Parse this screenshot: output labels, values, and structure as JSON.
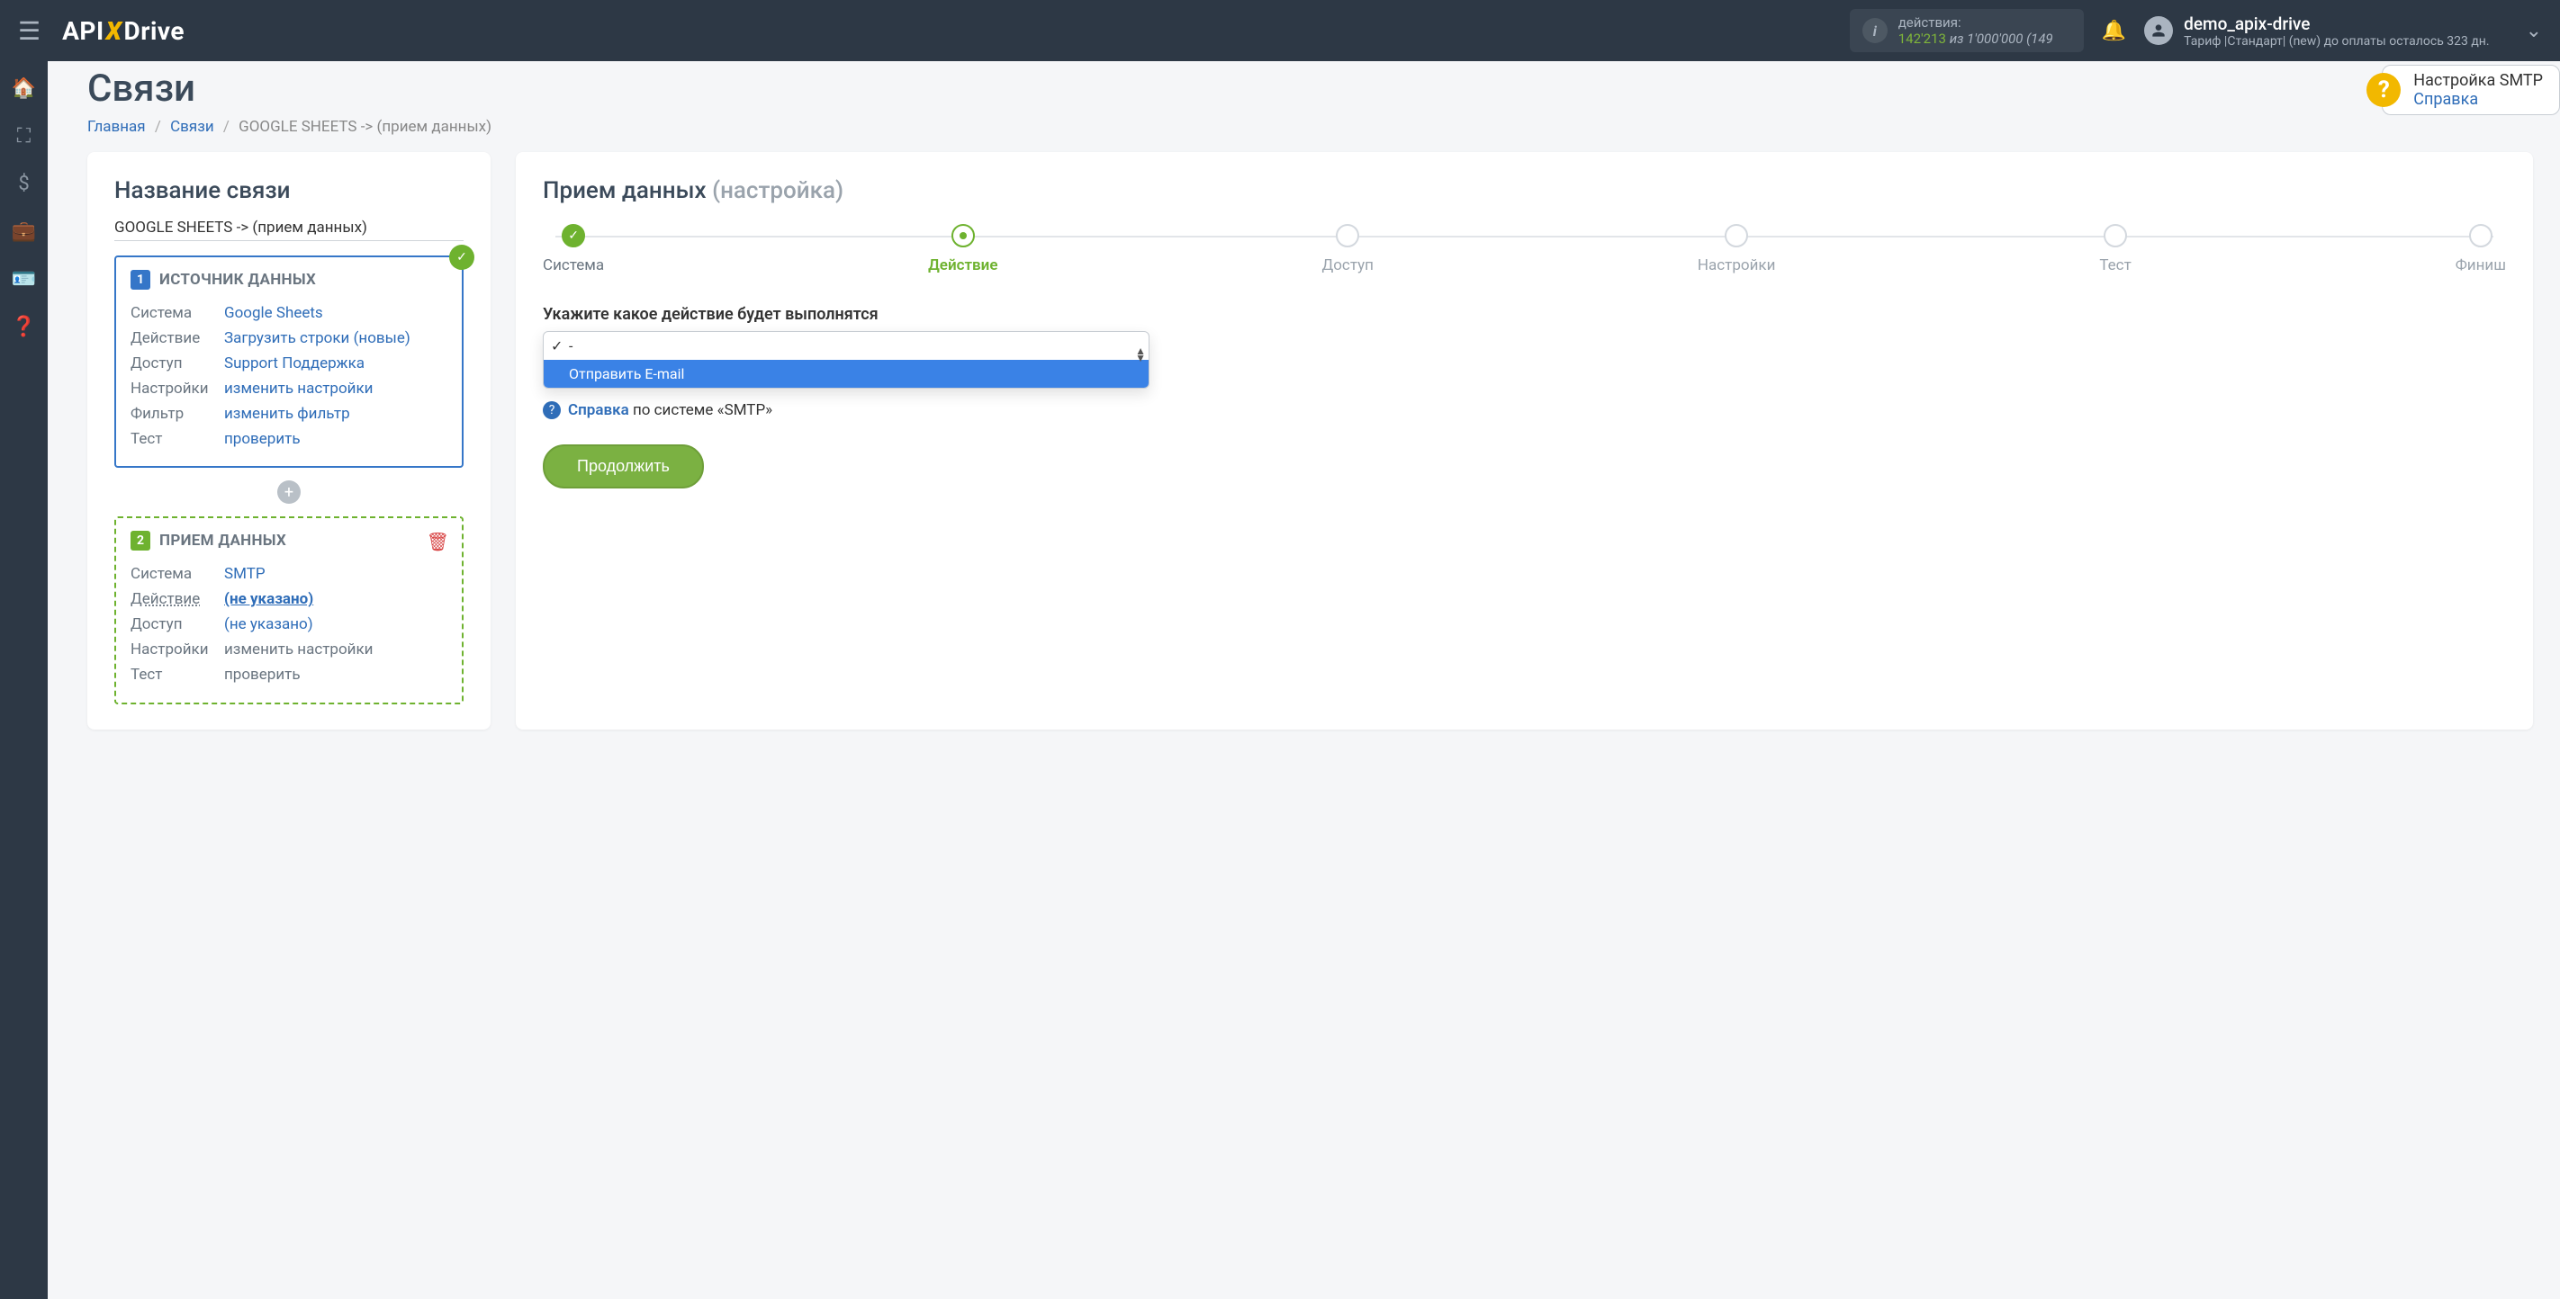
{
  "topbar": {
    "actions_label": "действия:",
    "actions_count": "142'213",
    "actions_of": "из",
    "actions_total": "1'000'000",
    "actions_rest": "(149",
    "user_name": "demo_apix-drive",
    "tariff": "Тариф |Стандарт| (new) до оплаты осталось 323 дн."
  },
  "help": {
    "title": "Настройка SMTP",
    "link": "Справка"
  },
  "page": {
    "title": "Связи",
    "crumb_home": "Главная",
    "crumb_links": "Связи",
    "crumb_current": "GOOGLE SHEETS -> (прием данных)"
  },
  "left": {
    "card_title": "Название связи",
    "link_name": "GOOGLE SHEETS -> (прием данных)",
    "source": {
      "num": "1",
      "title": "ИСТОЧНИК ДАННЫХ",
      "rows": [
        {
          "k": "Система",
          "v": "Google Sheets"
        },
        {
          "k": "Действие",
          "v": "Загрузить строки (новые)"
        },
        {
          "k": "Доступ",
          "v": "Support Поддержка"
        },
        {
          "k": "Настройки",
          "v": "изменить настройки"
        },
        {
          "k": "Фильтр",
          "v": "изменить фильтр"
        },
        {
          "k": "Тест",
          "v": "проверить"
        }
      ]
    },
    "dest": {
      "num": "2",
      "title": "ПРИЕМ ДАННЫХ",
      "rows": [
        {
          "k": "Система",
          "v": "SMTP",
          "vlink": true
        },
        {
          "k": "Действие",
          "v": "(не указано)",
          "kund": true,
          "vbold": true
        },
        {
          "k": "Доступ",
          "v": "(не указано)",
          "vlink": true
        },
        {
          "k": "Настройки",
          "v": "изменить настройки"
        },
        {
          "k": "Тест",
          "v": "проверить"
        }
      ]
    }
  },
  "right": {
    "title_main": "Прием данных",
    "title_muted": "(настройка)",
    "steps": [
      "Система",
      "Действие",
      "Доступ",
      "Настройки",
      "Тест",
      "Финиш"
    ],
    "field_label": "Укажите какое действие будет выполнятся",
    "options": [
      {
        "label": "-",
        "selected": true
      },
      {
        "label": "Отправить E-mail",
        "highlighted": true
      }
    ],
    "help_word": "Справка",
    "help_rest": "по системе «SMTP»",
    "continue": "Продолжить"
  }
}
